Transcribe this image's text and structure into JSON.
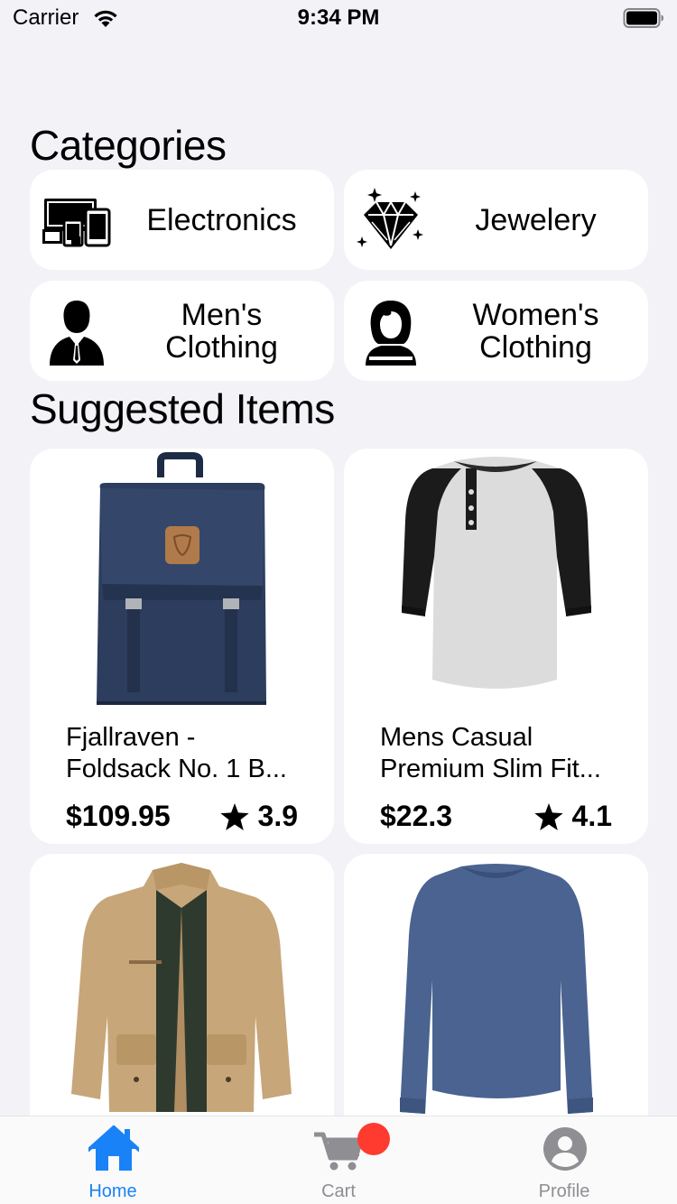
{
  "status_bar": {
    "carrier": "Carrier",
    "time": "9:34 PM"
  },
  "categories_section": {
    "title": "Categories"
  },
  "categories": [
    {
      "label": "Electronics",
      "icon": "devices-icon"
    },
    {
      "label": "Jewelery",
      "icon": "diamond-icon"
    },
    {
      "label": "Men's\nClothing",
      "icon": "man-icon"
    },
    {
      "label": "Women's\nClothing",
      "icon": "woman-icon"
    }
  ],
  "suggested_section": {
    "title": "Suggested Items"
  },
  "items": [
    {
      "title": "Fjallraven -\nFoldsack No. 1 B...",
      "price": "$109.95",
      "rating": "3.9",
      "image": "backpack"
    },
    {
      "title": "Mens Casual\nPremium Slim Fit...",
      "price": "$22.3",
      "rating": "4.1",
      "image": "raglan-tshirt"
    },
    {
      "title": "",
      "price": "",
      "rating": "",
      "image": "jacket"
    },
    {
      "title": "",
      "price": "",
      "rating": "",
      "image": "long-sleeve-shirt"
    }
  ],
  "tab_bar": {
    "tabs": [
      {
        "label": "Home",
        "icon": "home-icon",
        "active": true
      },
      {
        "label": "Cart",
        "icon": "cart-icon",
        "active": false
      },
      {
        "label": "Profile",
        "icon": "profile-icon",
        "active": false
      }
    ]
  },
  "colors": {
    "accent": "#1a82f7",
    "inactive": "#8e8e93",
    "badge": "#ff3b30",
    "background": "#f2f2f7"
  }
}
